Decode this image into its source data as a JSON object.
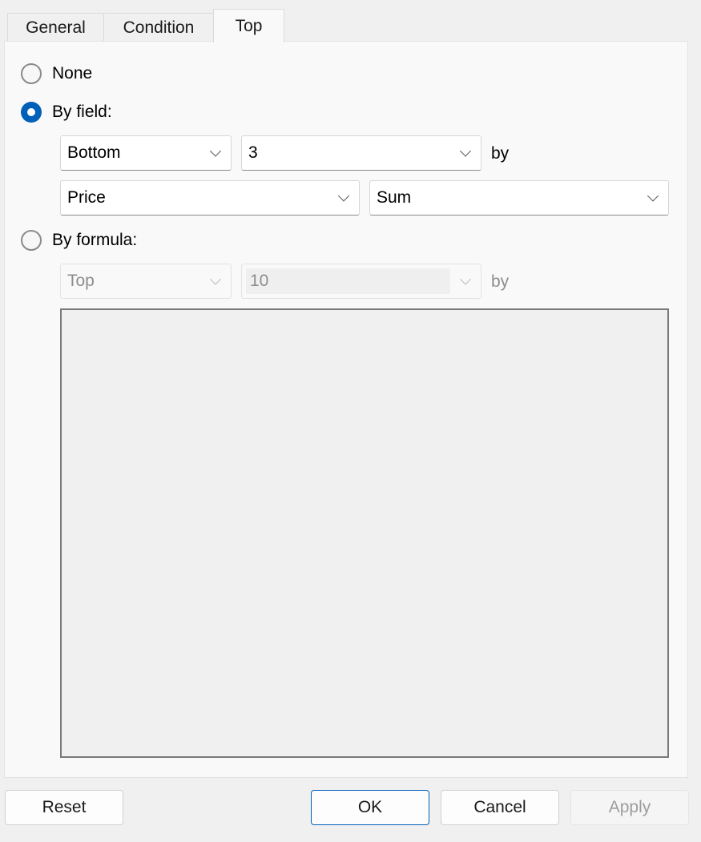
{
  "tabs": [
    {
      "label": "General"
    },
    {
      "label": "Condition"
    },
    {
      "label": "Top"
    }
  ],
  "active_tab": "Top",
  "options": {
    "none_label": "None",
    "by_field_label": "By field:",
    "by_formula_label": "By formula:",
    "selected": "By field:"
  },
  "by_field": {
    "direction": "Bottom",
    "count": "3",
    "by_label": "by",
    "field": "Price",
    "aggregate": "Sum"
  },
  "by_formula": {
    "direction": "Top",
    "count": "10",
    "by_label": "by",
    "formula_text": ""
  },
  "buttons": {
    "reset": "Reset",
    "ok": "OK",
    "cancel": "Cancel",
    "apply": "Apply"
  },
  "colors": {
    "accent": "#005fb8",
    "panel": "#f9f9f9",
    "window": "#f0f0f0"
  }
}
